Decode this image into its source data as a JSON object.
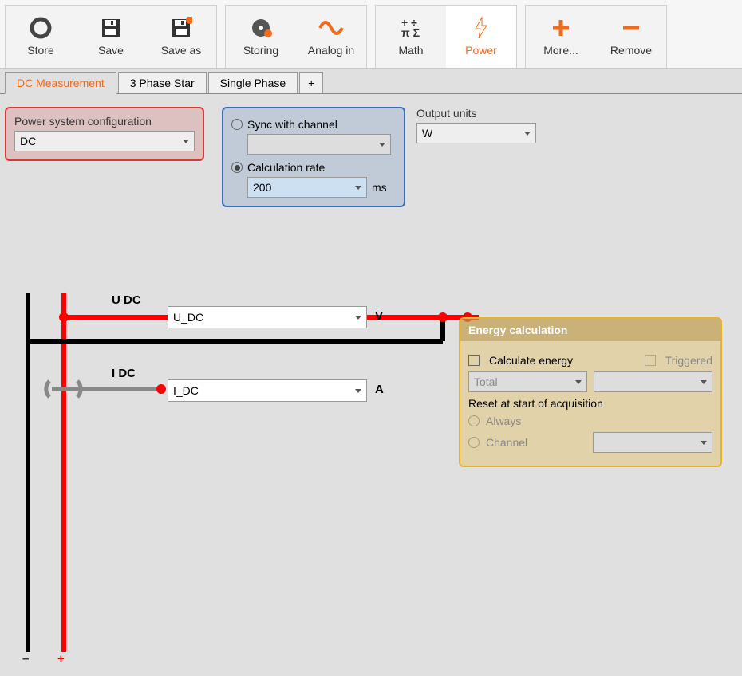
{
  "toolbar": {
    "store": "Store",
    "save": "Save",
    "save_as": "Save as",
    "storing": "Storing",
    "analog_in": "Analog in",
    "math": "Math",
    "power": "Power",
    "more": "More...",
    "remove": "Remove"
  },
  "tabs": {
    "dc_measurement": "DC Measurement",
    "three_phase_star": "3 Phase Star",
    "single_phase": "Single Phase",
    "plus": "+"
  },
  "config": {
    "power_system_label": "Power system configuration",
    "power_system_value": "DC",
    "sync_with_channel": "Sync with channel",
    "sync_value": "",
    "calc_rate_label": "Calculation rate",
    "calc_rate_value": "200",
    "calc_rate_unit": "ms",
    "output_units_label": "Output units",
    "output_units_value": "W"
  },
  "diagram": {
    "u_dc_label": "U DC",
    "u_dc_value": "U_DC",
    "u_unit": "V",
    "i_dc_label": "I DC",
    "i_dc_value": "I_DC",
    "i_unit": "A",
    "minus": "–",
    "plus": "+"
  },
  "energy": {
    "header": "Energy calculation",
    "calc_energy": "Calculate energy",
    "triggered": "Triggered",
    "total": "Total",
    "reset_label": "Reset at start of acquisition",
    "always": "Always",
    "channel": "Channel"
  }
}
